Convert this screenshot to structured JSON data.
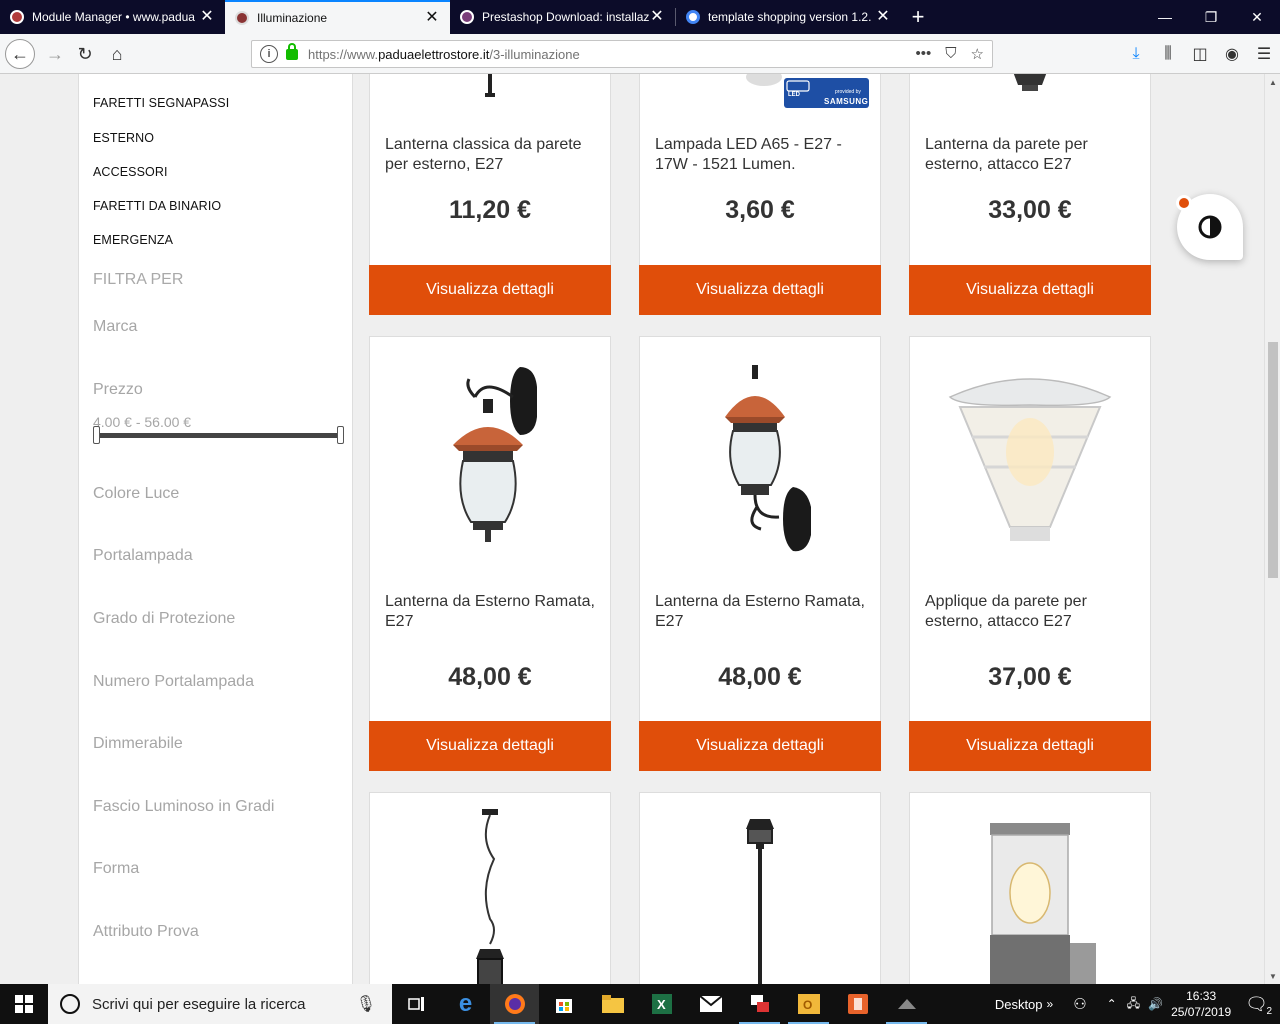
{
  "browser": {
    "tabs": [
      {
        "title": "Module Manager • www.padua",
        "favicon": "prestashop-favicon",
        "color": "#b13b3b"
      },
      {
        "title": "Illuminazione",
        "favicon": "prestashop-favicon",
        "color": "#8a3434",
        "active": true
      },
      {
        "title": "Prestashop Download: installaz",
        "favicon": "prestashop-favicon",
        "color": "#7a3e7a"
      },
      {
        "title": "template shopping version 1.2.",
        "favicon": "google-favicon",
        "color": "#4285f4"
      }
    ],
    "url": {
      "proto": "https://www.",
      "host": "paduaelettrostore.it",
      "path": "/3-illuminazione"
    }
  },
  "sidebar": {
    "categories": [
      "FARETTI SEGNAPASSI",
      "ESTERNO",
      "ACCESSORI",
      "FARETTI DA BINARIO",
      "EMERGENZA"
    ],
    "filter_heading": "FILTRA PER",
    "filters": [
      "Marca",
      "Prezzo",
      "Colore Luce",
      "Portalampada",
      "Grado di Protezione",
      "Numero Portalampada",
      "Dimmerabile",
      "Fascio Luminoso in Gradi",
      "Forma",
      "Attributo Prova"
    ],
    "price_range": "4.00 € - 56.00 €"
  },
  "products": [
    {
      "name": "Lanterna classica da parete per esterno, E27",
      "price": "11,20 €",
      "button": "Visualizza dettagli"
    },
    {
      "name": "Lampada LED A65 - E27 - 17W - 1521 Lumen.",
      "price": "3,60 €",
      "button": "Visualizza dettagli",
      "badge_top": "LED",
      "badge_small": "provided by",
      "badge_brand": "SAMSUNG"
    },
    {
      "name": "Lanterna da parete per esterno, attacco E27",
      "price": "33,00 €",
      "button": "Visualizza dettagli"
    },
    {
      "name": "Lanterna da Esterno Ramata, E27",
      "price": "48,00 €",
      "button": "Visualizza dettagli"
    },
    {
      "name": "Lanterna da Esterno Ramata, E27",
      "price": "48,00 €",
      "button": "Visualizza dettagli"
    },
    {
      "name": "Applique da parete per esterno, attacco E27",
      "price": "37,00 €",
      "button": "Visualizza dettagli"
    }
  ],
  "taskbar": {
    "search_placeholder": "Scrivi qui per eseguire la ricerca",
    "desktop_label": "Desktop",
    "time": "16:33",
    "date": "25/07/2019",
    "notification_count": "2"
  },
  "colors": {
    "accent": "#e04e0a",
    "tab_bg": "#0c0c29"
  }
}
